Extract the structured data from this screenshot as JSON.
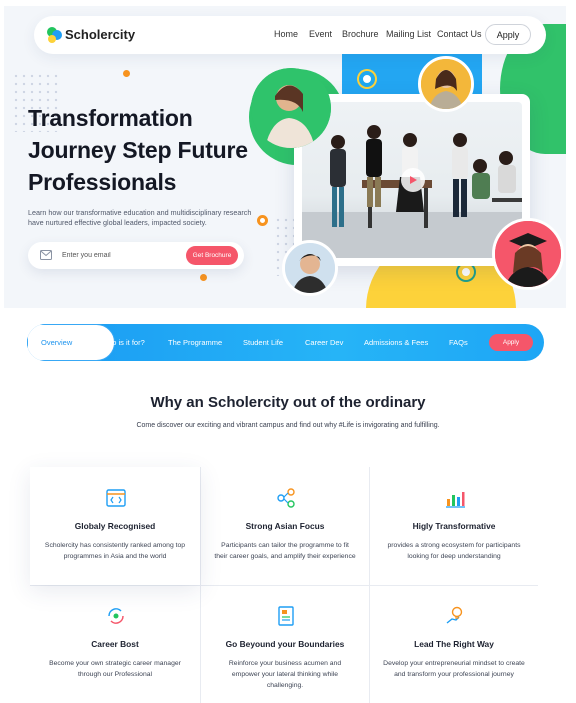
{
  "brand": {
    "name": "Scholercity"
  },
  "nav": {
    "links": [
      "Home",
      "Event",
      "Brochure",
      "Mailing List",
      "Contact Us"
    ],
    "apply_label": "Apply"
  },
  "hero": {
    "headline": "Transformation Journey Step Future Professionals",
    "subline": "Learn how our transformative education and multidisciplinary research have nurtured effective global leaders, impacted society.",
    "email_placeholder": "Enter you email",
    "brochure_button": "Get Brochure"
  },
  "tabs": {
    "active": "Overview",
    "items": [
      "Who is it for?",
      "The Programme",
      "Student Life",
      "Career Dev",
      "Admissions & Fees",
      "FAQs"
    ],
    "apply_label": "Apply"
  },
  "why": {
    "title": "Why an Scholercity out of the ordinary",
    "subtitle": "Come discover our exciting and vibrant campus and find out why #Life is invigorating and fulfilling."
  },
  "features": [
    {
      "icon": "code-window-icon",
      "title": "Globaly Recognised",
      "text": "Scholercity has consistently ranked among top programmes in Asia and the world"
    },
    {
      "icon": "network-nodes-icon",
      "title": "Strong Asian Focus",
      "text": "Participants can tailor the programme to fit their career goals, and amplify their experience"
    },
    {
      "icon": "bar-chart-icon",
      "title": "Higly Transformative",
      "text": "provides a strong ecosystem for participants looking for deep understanding"
    },
    {
      "icon": "career-cycle-icon",
      "title": "Career Bost",
      "text": "Become your own strategic career manager through our Professional"
    },
    {
      "icon": "document-icon",
      "title": "Go Beyound your Boundaries",
      "text": "Reinforce your business acumen and empower your lateral thinking while challenging."
    },
    {
      "icon": "lightbulb-hand-icon",
      "title": "Lead The Right Way",
      "text": "Develop your entrepreneurial mindset to create and transform your professional journey"
    }
  ],
  "colors": {
    "accent_blue": "#1e9ef4",
    "accent_red": "#f5566a",
    "accent_green": "#22c55e",
    "accent_yellow": "#fdd23a",
    "accent_orange": "#f7931e"
  }
}
